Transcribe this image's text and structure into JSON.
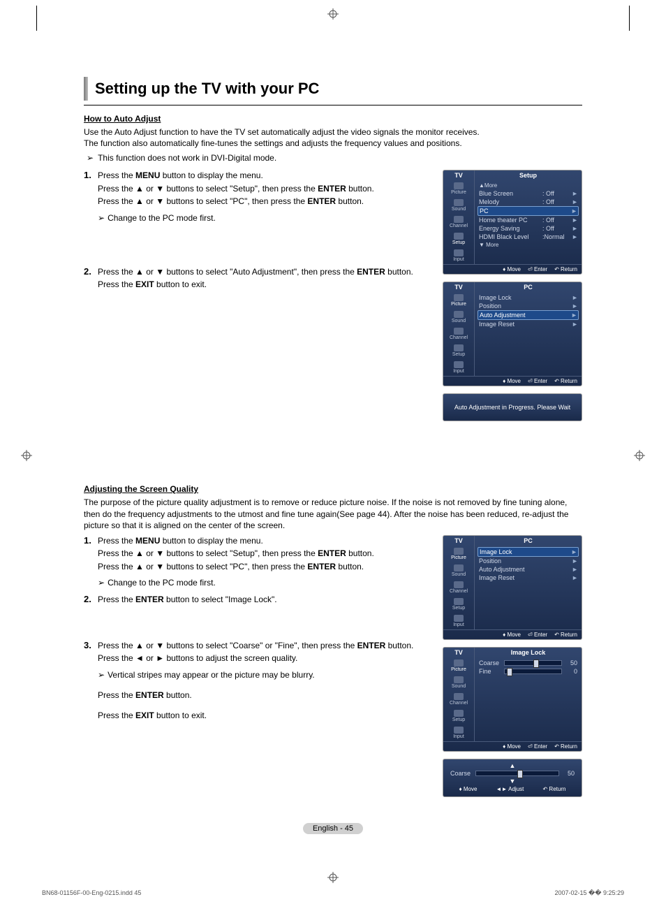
{
  "title": "Setting up the TV with your PC",
  "section1": {
    "heading": "How to Auto Adjust",
    "intro1": "Use the Auto Adjust function to have the TV set automatically adjust the video signals the monitor receives.",
    "intro2": "The function also automatically fine-tunes the settings and adjusts the frequency values and positions.",
    "note1": "This function does not work in DVI-Digital mode.",
    "steps": [
      {
        "num": "1.",
        "lines": [
          "Press the <b>MENU</b> button to display the menu.",
          "Press the ▲ or ▼ buttons to select \"Setup\", then press the <b>ENTER</b> button.",
          "Press the ▲ or ▼ buttons to select \"PC\", then press the <b>ENTER</b> button."
        ],
        "subnote": "Change to the PC mode first."
      },
      {
        "num": "2.",
        "lines": [
          "Press the ▲ or ▼ buttons to select \"Auto Adjustment\", then press the <b>ENTER</b> button.",
          "Press the <b>EXIT</b> button to exit."
        ]
      }
    ]
  },
  "osd1": {
    "tabL": "TV",
    "title": "Setup",
    "side": [
      "Picture",
      "Sound",
      "Channel",
      "Setup",
      "Input"
    ],
    "rows": [
      {
        "lbl": "▲More",
        "val": "",
        "more": true
      },
      {
        "lbl": "Blue Screen",
        "val": ": Off"
      },
      {
        "lbl": "Melody",
        "val": ": Off"
      },
      {
        "lbl": "PC",
        "val": "",
        "hl": true
      },
      {
        "lbl": "Home theater PC",
        "val": ": Off"
      },
      {
        "lbl": "Energy Saving",
        "val": ": Off"
      },
      {
        "lbl": "HDMI Black Level",
        "val": ":Normal"
      },
      {
        "lbl": "▼ More",
        "val": "",
        "more": true
      }
    ],
    "foot": {
      "move": "Move",
      "enter": "Enter",
      "return": "Return"
    }
  },
  "osd2": {
    "tabL": "TV",
    "title": "PC",
    "side": [
      "Picture",
      "Sound",
      "Channel",
      "Setup",
      "Input"
    ],
    "rows": [
      {
        "lbl": "Image Lock",
        "val": ""
      },
      {
        "lbl": "Position",
        "val": ""
      },
      {
        "lbl": "Auto Adjustment",
        "val": "",
        "hl": true
      },
      {
        "lbl": "Image Reset",
        "val": ""
      }
    ],
    "foot": {
      "move": "Move",
      "enter": "Enter",
      "return": "Return"
    }
  },
  "osd_popup": "Auto Adjustment in Progress. Please Wait",
  "section2": {
    "heading": "Adjusting the Screen Quality",
    "intro": "The purpose of the picture quality adjustment is to remove or reduce picture noise. If the noise is not removed by fine tuning alone, then do the frequency adjustments to the utmost and fine tune again(See page 44). After the noise has been reduced, re-adjust the picture so that it is aligned on the center of the screen.",
    "steps": [
      {
        "num": "1.",
        "lines": [
          "Press the <b>MENU</b> button to display the menu.",
          "Press the ▲ or ▼ buttons to select \"Setup\", then press the <b>ENTER</b> button.",
          "Press the ▲ or ▼ buttons to select \"PC\", then press the <b>ENTER</b> button."
        ],
        "subnote": "Change to the PC mode first."
      },
      {
        "num": "2.",
        "lines": [
          "Press the <b>ENTER</b> button to select \"Image Lock\"."
        ]
      },
      {
        "num": "3.",
        "lines": [
          "Press the ▲ or ▼ buttons to select \"Coarse\" or \"Fine\", then press the <b>ENTER</b> button.",
          "Press the ◄ or ► buttons to adjust the screen quality."
        ],
        "subnote": "Vertical stripes may appear or the picture may be blurry.",
        "tail": [
          "Press the <b>ENTER</b> button.",
          "Press the <b>EXIT</b> button to exit."
        ]
      }
    ]
  },
  "osd3": {
    "tabL": "TV",
    "title": "PC",
    "side": [
      "Picture",
      "Sound",
      "Channel",
      "Setup",
      "Input"
    ],
    "rows": [
      {
        "lbl": "Image Lock",
        "val": "",
        "hl": true
      },
      {
        "lbl": "Position",
        "val": ""
      },
      {
        "lbl": "Auto Adjustment",
        "val": ""
      },
      {
        "lbl": "Image Reset",
        "val": ""
      }
    ],
    "foot": {
      "move": "Move",
      "enter": "Enter",
      "return": "Return"
    }
  },
  "osd4": {
    "tabL": "TV",
    "title": "Image Lock",
    "side": [
      "Picture",
      "Sound",
      "Channel",
      "Setup",
      "Input"
    ],
    "sliders": [
      {
        "lbl": "Coarse",
        "val": "50",
        "pos": 50,
        "hl": true
      },
      {
        "lbl": "Fine",
        "val": "0",
        "pos": 4
      }
    ],
    "foot": {
      "move": "Move",
      "enter": "Enter",
      "return": "Return"
    }
  },
  "osd5": {
    "label": "Coarse",
    "val": "50",
    "pos": 50,
    "foot": {
      "move": "Move",
      "adjust": "Adjust",
      "return": "Return"
    }
  },
  "page_label": "English - 45",
  "doc_foot_left": "BN68-01156F-00-Eng-0215.indd   45",
  "doc_foot_right": "2007-02-15   �� 9:25:29"
}
